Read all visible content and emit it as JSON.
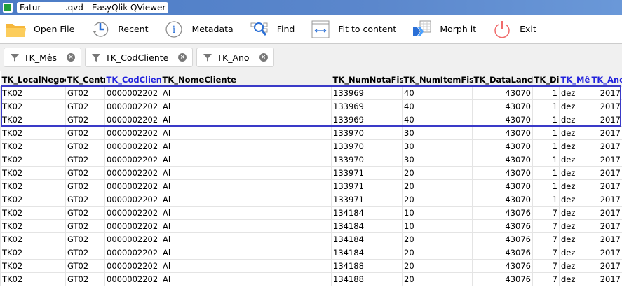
{
  "window": {
    "title_prefix": "Fatur",
    "title_suffix": ".qvd - EasyQlik QViewer"
  },
  "toolbar": [
    {
      "label": "Open File",
      "icon": "folder-icon"
    },
    {
      "label": "Recent",
      "icon": "clock-icon"
    },
    {
      "label": "Metadata",
      "icon": "info-icon"
    },
    {
      "label": "Find",
      "icon": "find-icon"
    },
    {
      "label": "Fit to content",
      "icon": "fit-icon"
    },
    {
      "label": "Morph it",
      "icon": "morph-icon"
    },
    {
      "label": "Exit",
      "icon": "power-icon"
    }
  ],
  "filters": [
    "TK_Mês",
    "TK_CodCliente",
    "TK_Ano"
  ],
  "columns": [
    "TK_LocalNegocio",
    "TK_Centro",
    "TK_CodCliente",
    "TK_NomeCliente",
    "TK_NumNotaFiscal",
    "TK_NumItemFiscal",
    "TK_DataLancNF",
    "TK_Dia",
    "TK_Mês",
    "TK_Ano"
  ],
  "filtered_columns": [
    "TK_CodCliente",
    "TK_Mês",
    "TK_Ano"
  ],
  "rows": [
    [
      "TK02",
      "GT02",
      "0000002202",
      "Al",
      "133969",
      "40",
      "43070",
      "1",
      "dez",
      "2017"
    ],
    [
      "TK02",
      "GT02",
      "0000002202",
      "Al",
      "133969",
      "40",
      "43070",
      "1",
      "dez",
      "2017"
    ],
    [
      "TK02",
      "GT02",
      "0000002202",
      "Al",
      "133969",
      "40",
      "43070",
      "1",
      "dez",
      "2017"
    ],
    [
      "TK02",
      "GT02",
      "0000002202",
      "Al",
      "133970",
      "30",
      "43070",
      "1",
      "dez",
      "2017"
    ],
    [
      "TK02",
      "GT02",
      "0000002202",
      "Al",
      "133970",
      "30",
      "43070",
      "1",
      "dez",
      "2017"
    ],
    [
      "TK02",
      "GT02",
      "0000002202",
      "Al",
      "133970",
      "30",
      "43070",
      "1",
      "dez",
      "2017"
    ],
    [
      "TK02",
      "GT02",
      "0000002202",
      "Al",
      "133971",
      "20",
      "43070",
      "1",
      "dez",
      "2017"
    ],
    [
      "TK02",
      "GT02",
      "0000002202",
      "Al",
      "133971",
      "20",
      "43070",
      "1",
      "dez",
      "2017"
    ],
    [
      "TK02",
      "GT02",
      "0000002202",
      "Al",
      "133971",
      "20",
      "43070",
      "1",
      "dez",
      "2017"
    ],
    [
      "TK02",
      "GT02",
      "0000002202",
      "Al",
      "134184",
      "10",
      "43076",
      "7",
      "dez",
      "2017"
    ],
    [
      "TK02",
      "GT02",
      "0000002202",
      "Al",
      "134184",
      "10",
      "43076",
      "7",
      "dez",
      "2017"
    ],
    [
      "TK02",
      "GT02",
      "0000002202",
      "Al",
      "134184",
      "20",
      "43076",
      "7",
      "dez",
      "2017"
    ],
    [
      "TK02",
      "GT02",
      "0000002202",
      "Al",
      "134184",
      "20",
      "43076",
      "7",
      "dez",
      "2017"
    ],
    [
      "TK02",
      "GT02",
      "0000002202",
      "Al",
      "134188",
      "20",
      "43076",
      "7",
      "dez",
      "2017"
    ],
    [
      "TK02",
      "GT02",
      "0000002202",
      "Al",
      "134188",
      "20",
      "43076",
      "7",
      "dez",
      "2017"
    ]
  ],
  "colors": {
    "highlight": "#3a3ac8",
    "filtered_header": "#2222dd"
  }
}
